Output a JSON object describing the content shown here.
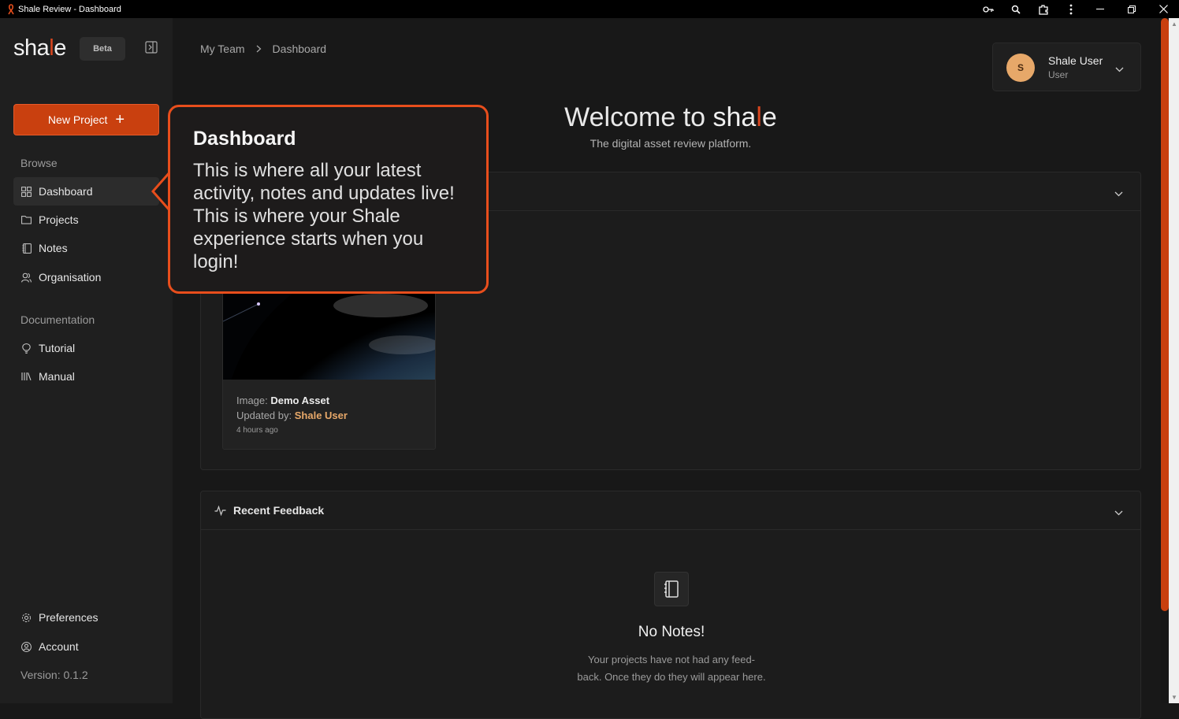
{
  "window": {
    "title": "Shale Review - Dashboard",
    "icons": [
      "key-icon",
      "zoom-icon",
      "extension-icon",
      "more-icon"
    ],
    "controls": [
      "minimize",
      "restore",
      "close"
    ]
  },
  "sidebar": {
    "logo_prefix": "sha",
    "logo_l": "l",
    "logo_suffix": "e",
    "beta_label": "Beta",
    "new_project_label": "New Project",
    "browse_label": "Browse",
    "browse_items": [
      {
        "label": "Dashboard",
        "icon": "grid-icon",
        "active": true
      },
      {
        "label": "Projects",
        "icon": "folder-icon"
      },
      {
        "label": "Notes",
        "icon": "notebook-icon"
      },
      {
        "label": "Organisation",
        "icon": "users-icon"
      }
    ],
    "documentation_label": "Documentation",
    "documentation_items": [
      {
        "label": "Tutorial",
        "icon": "lightbulb-icon"
      },
      {
        "label": "Manual",
        "icon": "library-icon"
      }
    ],
    "footer_items": [
      {
        "label": "Preferences",
        "icon": "gear-icon"
      },
      {
        "label": "Account",
        "icon": "account-icon"
      }
    ],
    "version": "Version: 0.1.2"
  },
  "header": {
    "breadcrumb": [
      "My Team",
      "Dashboard"
    ],
    "user": {
      "initial": "S",
      "name": "Shale User",
      "role": "User"
    }
  },
  "welcome": {
    "prefix": "Welcome to ",
    "brand_prefix": "sha",
    "brand_l": "l",
    "brand_suffix": "e",
    "subtitle": "The digital asset review platform."
  },
  "recent_activity": {
    "asset": {
      "type_label": "Image:",
      "name": "Demo Asset",
      "updated_label": "Updated by:",
      "updated_by": "Shale User",
      "time": "4 hours ago"
    }
  },
  "recent_feedback": {
    "title": "Recent Feedback",
    "empty_title": "No Notes!",
    "empty_line1": "Your projects have not had any feed-",
    "empty_line2": "back. Once they do they will appear here."
  },
  "tooltip": {
    "title": "Dashboard",
    "body": "This is where all your latest activity, notes and updates live! This is where your Shale experience starts when you login!"
  },
  "colors": {
    "accent": "#c9400f",
    "tooltip_border": "#e84e1c",
    "avatar": "#e7a869",
    "background": "#181818",
    "sidebar": "#1f1f1f"
  }
}
